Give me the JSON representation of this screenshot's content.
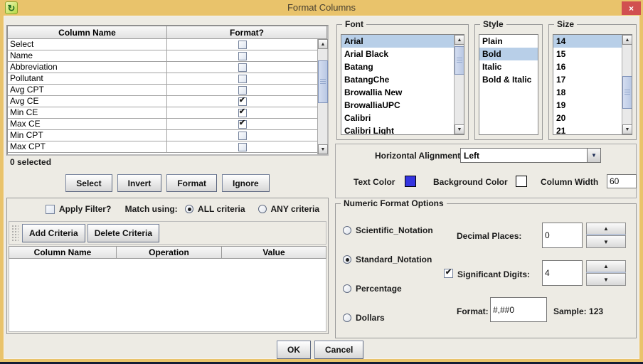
{
  "window": {
    "title": "Format Columns",
    "close_glyph": "×"
  },
  "column_table": {
    "headers": [
      "Column Name",
      "Format?"
    ],
    "rows": [
      {
        "name": "Select",
        "checked": false
      },
      {
        "name": "Name",
        "checked": false
      },
      {
        "name": "Abbreviation",
        "checked": false
      },
      {
        "name": "Pollutant",
        "checked": false
      },
      {
        "name": "Avg CPT",
        "checked": false
      },
      {
        "name": "Avg CE",
        "checked": true
      },
      {
        "name": "Min CE",
        "checked": true
      },
      {
        "name": "Max CE",
        "checked": true
      },
      {
        "name": "Min CPT",
        "checked": false
      },
      {
        "name": "Max CPT",
        "checked": false
      }
    ],
    "status": "0 selected"
  },
  "actions": {
    "select": "Select",
    "invert": "Invert",
    "format": "Format",
    "ignore": "Ignore"
  },
  "filter": {
    "apply_label": "Apply Filter?",
    "apply_checked": false,
    "match_label": "Match using:",
    "options": [
      {
        "label": "ALL criteria",
        "selected": true
      },
      {
        "label": "ANY criteria",
        "selected": false
      }
    ],
    "add_button": "Add Criteria",
    "delete_button": "Delete Criteria",
    "table_headers": [
      "Column Name",
      "Operation",
      "Value"
    ]
  },
  "font_panel": {
    "title": "Font",
    "selected": "Arial",
    "items": [
      "Arial",
      "Arial Black",
      "Batang",
      "BatangChe",
      "Browallia New",
      "BrowalliaUPC",
      "Calibri",
      "Calibri Light"
    ]
  },
  "style_panel": {
    "title": "Style",
    "selected": "Bold",
    "items": [
      "Plain",
      "Bold",
      "Italic",
      "Bold & Italic"
    ]
  },
  "size_panel": {
    "title": "Size",
    "selected": "14",
    "items": [
      "14",
      "15",
      "16",
      "17",
      "18",
      "19",
      "20",
      "21"
    ]
  },
  "alignment": {
    "label": "Horizontal Alignment",
    "value": "Left"
  },
  "appearance": {
    "text_color_label": "Text Color",
    "text_color": "#3434e0",
    "background_color_label": "Background Color",
    "background_color": "#ffffff",
    "column_width_label": "Column Width",
    "column_width": "60"
  },
  "numeric": {
    "title": "Numeric Format Options",
    "radios": [
      {
        "label": "Scientific_Notation",
        "selected": false
      },
      {
        "label": "Standard_Notation",
        "selected": true
      },
      {
        "label": "Percentage",
        "selected": false
      },
      {
        "label": "Dollars",
        "selected": false
      }
    ],
    "decimal_places_label": "Decimal Places:",
    "decimal_places_value": "0",
    "significant_digits_label": "Significant Digits:",
    "significant_digits_checked": true,
    "significant_digits_value": "4",
    "format_label": "Format:",
    "format_value": "#,##0",
    "sample_label": "Sample: 123"
  },
  "footer": {
    "ok": "OK",
    "cancel": "Cancel"
  }
}
